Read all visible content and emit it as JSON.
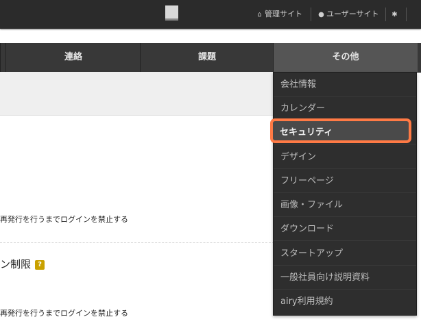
{
  "header": {
    "admin_link": "管理サイト",
    "user_link": "ユーザーサイト"
  },
  "tabs": [
    {
      "label": "連絡"
    },
    {
      "label": "課題"
    },
    {
      "label": "その他"
    }
  ],
  "content": {
    "text1": "再発行を行うまでログインを禁止する",
    "heading": "ン制限",
    "help_badge": "?",
    "text2": "再発行を行うまでログインを禁止する"
  },
  "menu": {
    "items": [
      {
        "label": "会社情報"
      },
      {
        "label": "カレンダー"
      },
      {
        "label": "セキュリティ"
      },
      {
        "label": "デザイン"
      },
      {
        "label": "フリーページ"
      },
      {
        "label": "画像・ファイル"
      },
      {
        "label": "ダウンロード"
      },
      {
        "label": "スタートアップ"
      },
      {
        "label": "一般社員向け説明資料"
      },
      {
        "label": "airy利用規約"
      }
    ],
    "highlighted_index": 2
  },
  "colors": {
    "highlight_border": "#ff7a45",
    "help_badge": "#c9a100"
  }
}
